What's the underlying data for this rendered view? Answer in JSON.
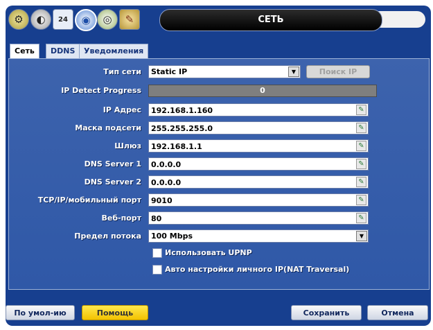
{
  "window": {
    "title": "СЕТЬ"
  },
  "toolbar_icons": [
    "gear-icon",
    "toggle-icon",
    "calendar-icon",
    "network-globe-icon",
    "disc-icon",
    "tools-icon"
  ],
  "calendar_day": "24",
  "tabs": [
    {
      "label": "Сеть",
      "active": true
    },
    {
      "label": "DDNS",
      "active": false
    },
    {
      "label": "Уведомления",
      "active": false
    }
  ],
  "form": {
    "network_type": {
      "label": "Тип сети",
      "value": "Static IP"
    },
    "search_ip_label": "Поиск IP",
    "ip_detect_progress": {
      "label": "IP Detect Progress",
      "value": "0"
    },
    "ip_address": {
      "label": "IP Адрес",
      "value": "192.168.1.160"
    },
    "subnet_mask": {
      "label": "Маска подсети",
      "value": "255.255.255.0"
    },
    "gateway": {
      "label": "Шлюз",
      "value": "192.168.1.1"
    },
    "dns1": {
      "label": "DNS Server 1",
      "value": "0.0.0.0"
    },
    "dns2": {
      "label": "DNS Server 2",
      "value": "0.0.0.0"
    },
    "tcp_port": {
      "label": "TCP/IP/мобильный порт",
      "value": "9010"
    },
    "web_port": {
      "label": "Веб-порт",
      "value": "80"
    },
    "bandwidth": {
      "label": "Предел потока",
      "value": "100 Mbps"
    },
    "use_upnp": {
      "label": "Использовать UPNP",
      "checked": false
    },
    "nat_traversal": {
      "label": "Авто настройки личного IP(NAT Traversal)",
      "checked": false
    }
  },
  "buttons": {
    "defaults": "По умол-ию",
    "help": "Помощь",
    "save": "Сохранить",
    "cancel": "Отмена"
  },
  "colors": {
    "background": "#173f8f",
    "panel": "#3a60ab",
    "help_button": "#f5c800"
  }
}
